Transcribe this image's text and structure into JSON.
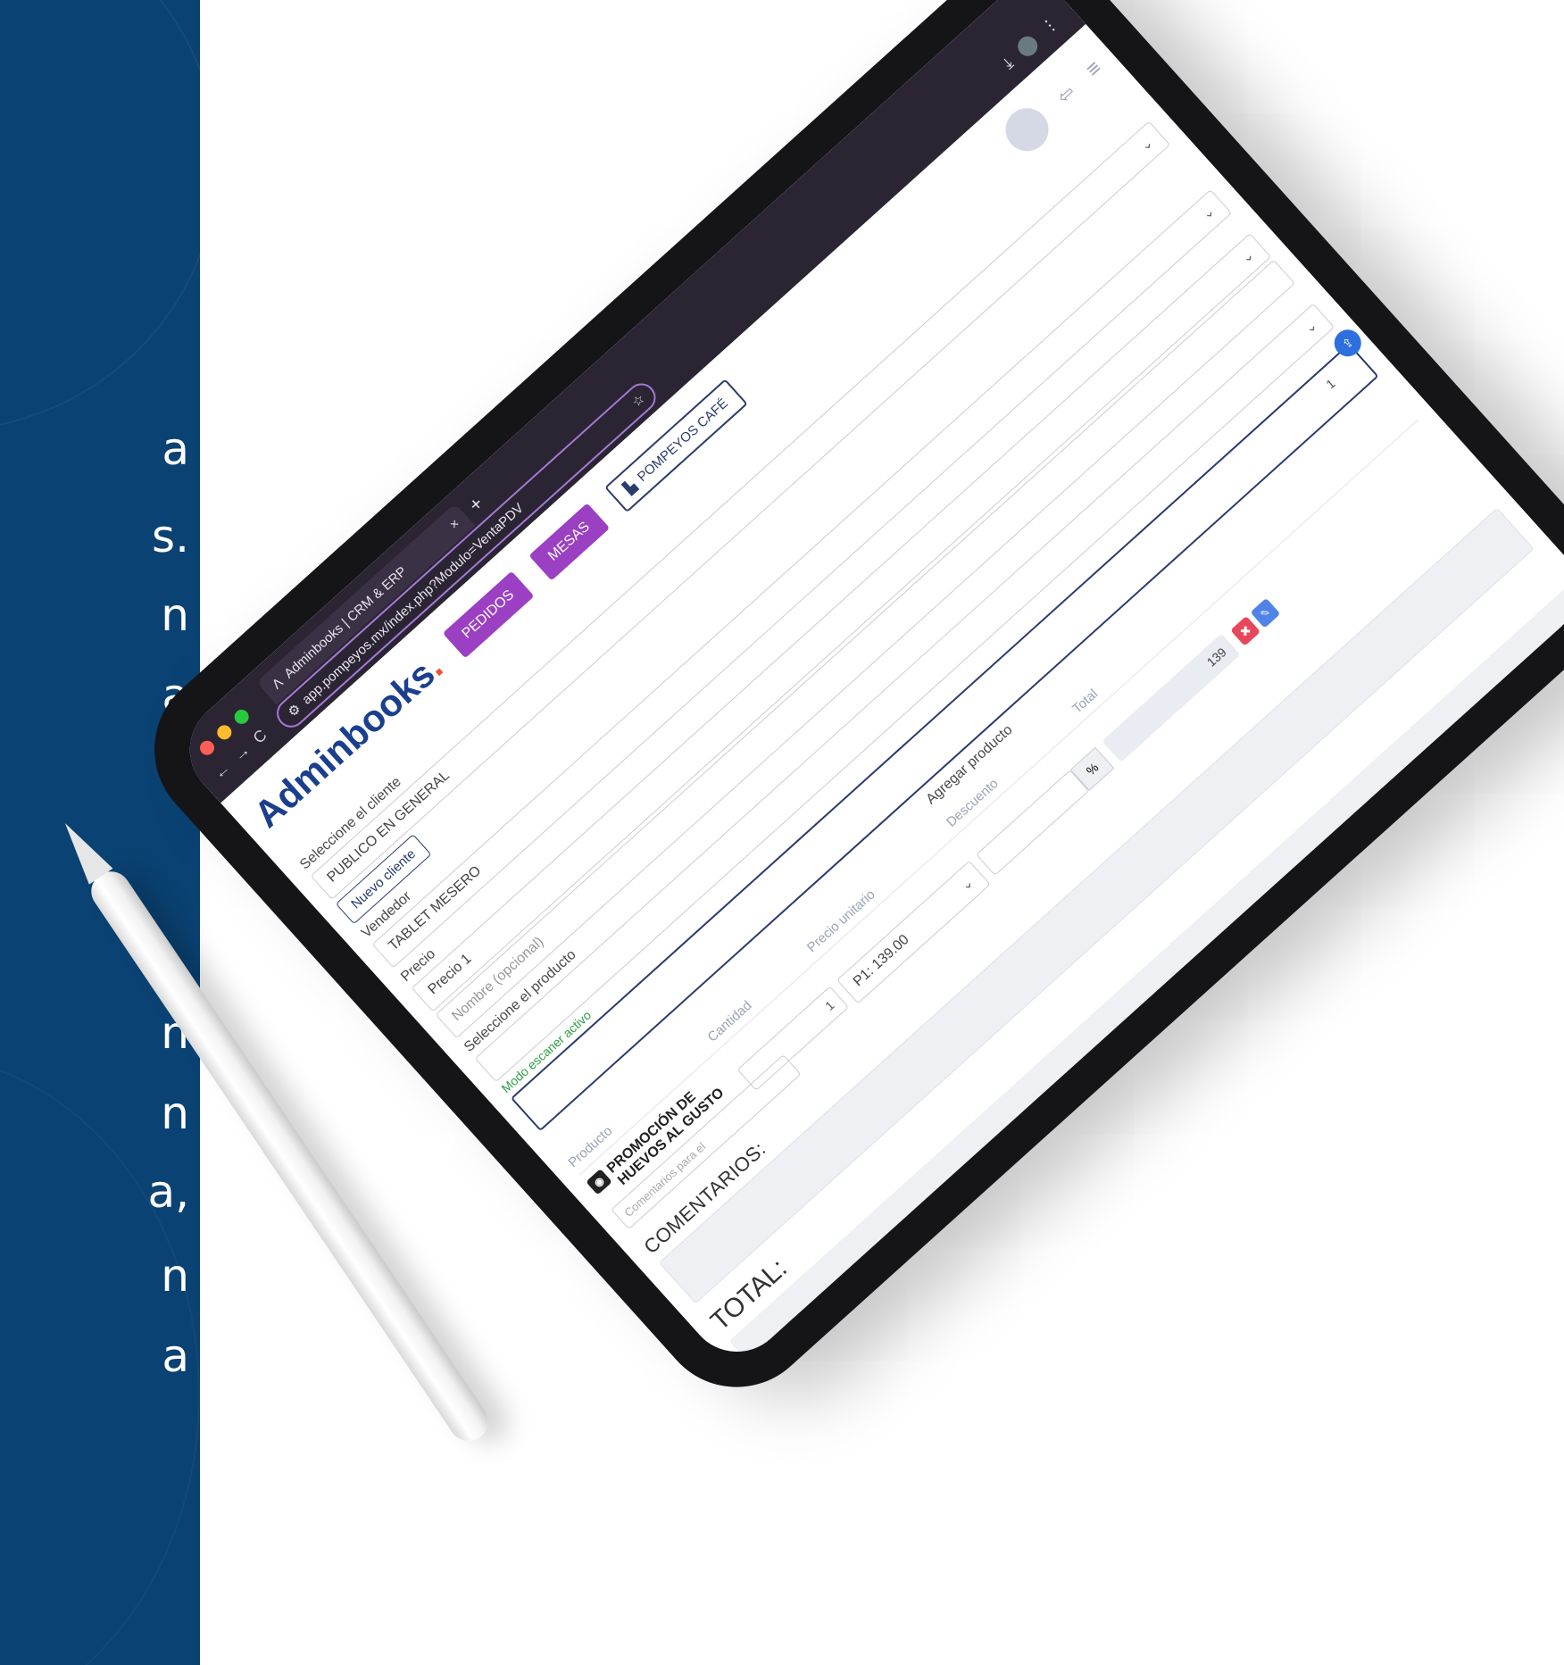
{
  "left_text_fragments": [
    "a",
    "s.",
    "n",
    "a",
    "n",
    "n",
    "a,",
    "n",
    "a"
  ],
  "browser": {
    "tab_title": "Adminbooks | CRM & ERP",
    "tab_close": "×",
    "new_tab": "+",
    "url": "app.pompeyos.mx/index.php?Modulo=VentaPDV",
    "back": "←",
    "forward": "→",
    "reload": "C",
    "star": "☆",
    "download": "⤓",
    "more": "⋮"
  },
  "app": {
    "brand": "Adminbooks",
    "brand_dot": ".",
    "btn_pedidos": "PEDIDOS",
    "btn_mesas": "MESAS",
    "store_label": "POMPEYOS CAFÉ",
    "menu": "≡",
    "logout": "⇦"
  },
  "form": {
    "client_label": "Seleccione el cliente",
    "client_value": "PUBLICO EN GENERAL",
    "new_client": "Nuevo cliente",
    "seller_label": "Vendedor",
    "seller_value": "TABLET MESERO",
    "price_label": "Precio",
    "price_value": "Precio 1",
    "name_placeholder": "Nombre (opcional)",
    "product_label": "Seleccione el producto",
    "scanner_mode": "Modo escaner activo",
    "scan_qty": "1",
    "add_product": "Agregar producto"
  },
  "table": {
    "headers": [
      "Producto",
      "Cantidad",
      "Precio unitario",
      "Descuento",
      "Total"
    ],
    "row": {
      "product": "PROMOCIÓN DE HUEVOS AL GUSTO",
      "comment_placeholder": "Comentarios para el",
      "quantity": "1",
      "price": "P1: 139.00",
      "discount_symbol": "%",
      "total": "139"
    }
  },
  "summary": {
    "comments_label": "COMENTARIOS:",
    "total_label": "TOTAL:"
  },
  "colors": {
    "left_panel": "#0a4273",
    "purple": "#9b3fc3",
    "navy": "#2a3b6e",
    "green": "#2f9e44"
  }
}
